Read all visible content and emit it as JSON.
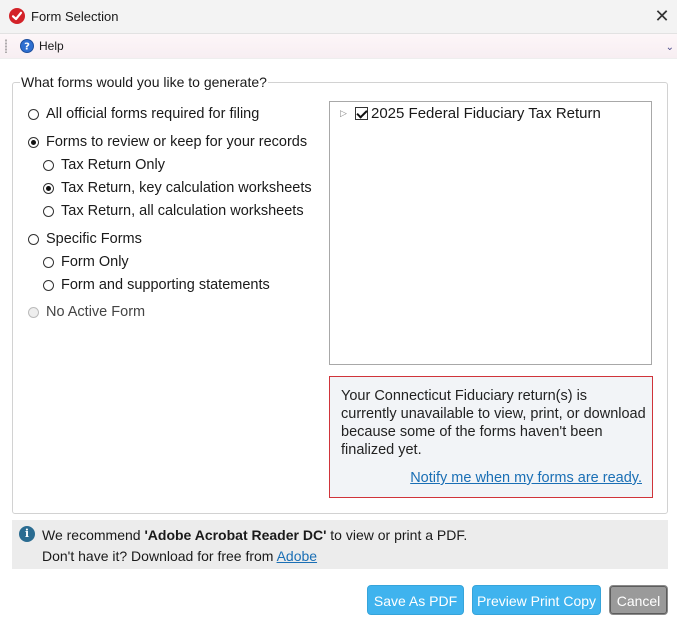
{
  "window": {
    "title": "Form Selection"
  },
  "menu": {
    "help_label": "Help"
  },
  "group": {
    "legend": "What forms would you like to generate?"
  },
  "options": {
    "all_official": "All official forms required for filing",
    "review_keep": "Forms to review or keep for your records",
    "tax_return_only": "Tax Return Only",
    "tax_return_key": "Tax Return, key calculation worksheets",
    "tax_return_all": "Tax Return, all calculation worksheets",
    "specific_forms": "Specific Forms",
    "form_only": "Form Only",
    "form_supporting": "Form and supporting statements",
    "no_active_form": "No Active Form"
  },
  "tree": {
    "item_label": "2025 Federal Fiduciary Tax Return",
    "checked": true
  },
  "notice": {
    "text": "Your Connecticut Fiduciary return(s) is currently unavailable to view, print, or download because some of the forms haven't been finalized yet.",
    "link": "Notify me when my forms are ready."
  },
  "info": {
    "prefix": "We recommend ",
    "app_name": "'Adobe Acrobat Reader DC'",
    "suffix": " to view or print a PDF.",
    "line2": "Don't have it? Download for free from ",
    "link": "Adobe"
  },
  "buttons": {
    "save_pdf": "Save As PDF",
    "preview": "Preview Print Copy",
    "cancel": "Cancel"
  },
  "colors": {
    "accent_button": "#3fb3ee",
    "notice_border": "#d0343a",
    "link": "#1a6fb5",
    "cancel_button": "#9a9a9a"
  }
}
